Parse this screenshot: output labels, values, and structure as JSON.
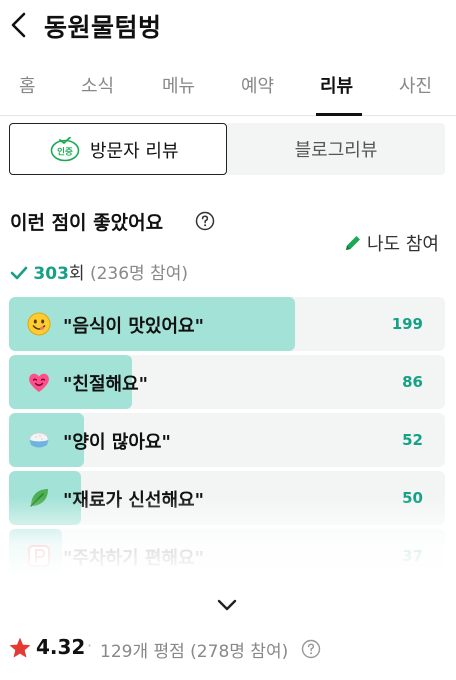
{
  "header": {
    "title": "동원물텀벙"
  },
  "tabs": [
    {
      "label": "홈"
    },
    {
      "label": "소식"
    },
    {
      "label": "메뉴"
    },
    {
      "label": "예약"
    },
    {
      "label": "리뷰"
    },
    {
      "label": "사진"
    }
  ],
  "active_tab": "리뷰",
  "review_toggle": {
    "badge_text": "인증",
    "visit_label": "방문자 리뷰",
    "blog_label": "블로그리뷰"
  },
  "keywords_section": {
    "title": "이런 점이 좋았어요",
    "write_label": "나도 참여",
    "total_count": "303",
    "count_unit": "회",
    "participants": "(236명 참여)",
    "items": [
      {
        "label": "\"음식이 맛있어요\"",
        "count": "199",
        "emoji": "smiley-face-icon",
        "fraction": 0.656
      },
      {
        "label": "\"친절해요\"",
        "count": "86",
        "emoji": "heart-face-icon",
        "fraction": 0.283
      },
      {
        "label": "\"양이 많아요\"",
        "count": "52",
        "emoji": "rice-bowl-icon",
        "fraction": 0.171
      },
      {
        "label": "\"재료가 신선해요\"",
        "count": "50",
        "emoji": "leaf-icon",
        "fraction": 0.165
      },
      {
        "label": "\"주차하기 편해요\"",
        "count": "37",
        "emoji": "parking-icon",
        "fraction": 0.122
      }
    ]
  },
  "rating": {
    "score": "4.32",
    "separator": "·",
    "summary": "129개 평점 (278명 참여)"
  },
  "colors": {
    "accent": "#16a085",
    "bar_fill": "#a3e2d7",
    "star": "#e53935"
  }
}
